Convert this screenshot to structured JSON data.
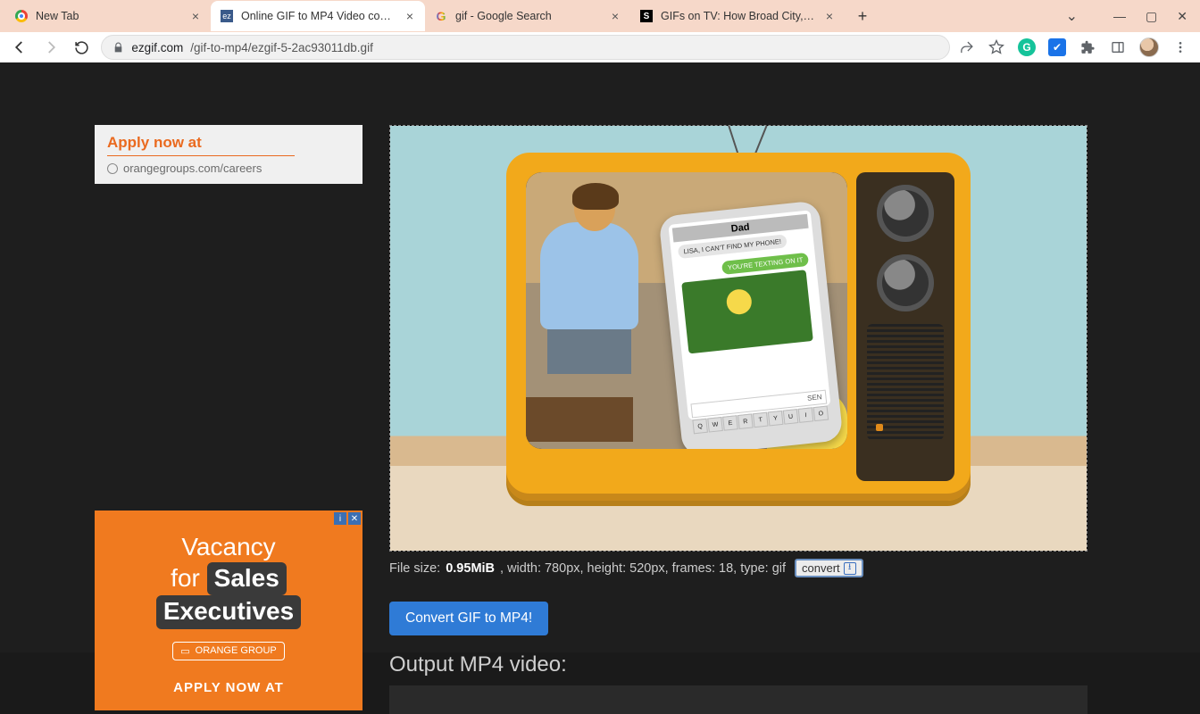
{
  "tabs": [
    {
      "title": "New Tab"
    },
    {
      "title": "Online GIF to MP4 Video convert"
    },
    {
      "title": "gif - Google Search"
    },
    {
      "title": "GIFs on TV: How Broad City, The"
    }
  ],
  "url": {
    "host": "ezgif.com",
    "path": "/gif-to-mp4/ezgif-5-2ac93011db.gif"
  },
  "ad1": {
    "line1": "Apply now at",
    "line2": "orangegroups.com/careers"
  },
  "ad2": {
    "word_vacancy": "Vacancy",
    "word_for": "for",
    "word_sales": "Sales",
    "word_exec": "Executives",
    "chip": "ORANGE GROUP",
    "apply": "APPLY NOW AT"
  },
  "phone": {
    "header": "Dad",
    "msg_grey": "LISA, I CAN'T FIND MY PHONE!",
    "msg_green": "YOU'RE TEXTING ON IT",
    "send": "SEN",
    "keys": [
      "Q",
      "W",
      "E",
      "R",
      "T",
      "Y",
      "U",
      "I",
      "O"
    ]
  },
  "info": {
    "prefix": "File size: ",
    "size": "0.95MiB",
    "rest1": ", width: 780px, height: 520px, frames: 18, type: gif",
    "convert": "convert"
  },
  "convert_btn": "Convert GIF to MP4!",
  "output_heading": "Output MP4 video:"
}
